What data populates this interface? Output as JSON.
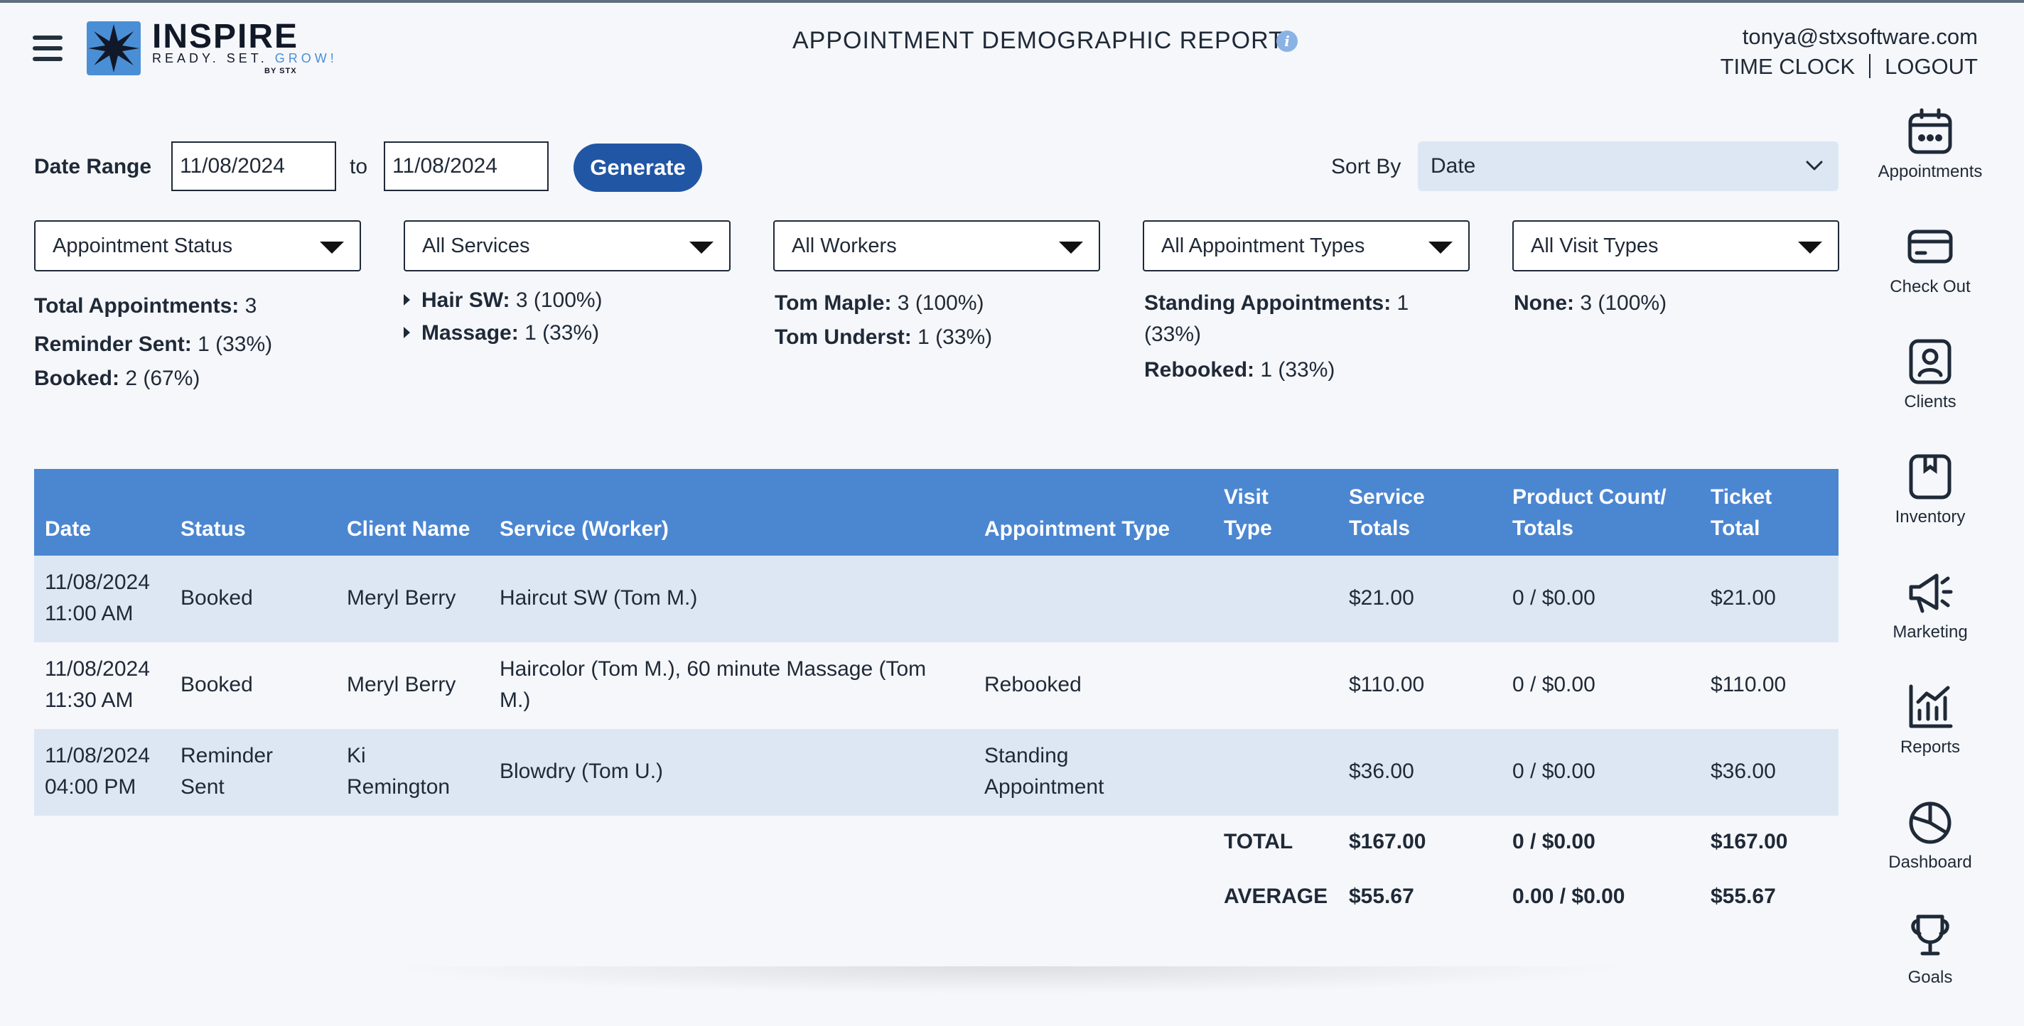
{
  "header": {
    "brand_name": "INSPIRE",
    "brand_tagline_main": "READY. SET. ",
    "brand_tagline_accent": "GROW!",
    "brand_by": "BY STX",
    "title": "APPOINTMENT DEMOGRAPHIC REPORT",
    "user_email": "tonya@stxsoftware.com",
    "time_clock": "TIME CLOCK",
    "logout": "LOGOUT"
  },
  "filters": {
    "date_range_label": "Date Range",
    "date_from": "11/08/2024",
    "to_label": "to",
    "date_to": "11/08/2024",
    "generate_label": "Generate",
    "sort_by_label": "Sort By",
    "sort_by_value": "Date",
    "dropdowns": [
      "Appointment Status",
      "All Services",
      "All Workers",
      "All Appointment Types",
      "All Visit Types"
    ]
  },
  "summary": {
    "status": [
      {
        "label": "Total Appointments:",
        "value": "3"
      },
      {
        "label": "Reminder Sent:",
        "value": "1 (33%)"
      },
      {
        "label": "Booked:",
        "value": "2 (67%)"
      }
    ],
    "services": [
      {
        "label": "Hair SW:",
        "value": "3 (100%)"
      },
      {
        "label": "Massage:",
        "value": "1 (33%)"
      }
    ],
    "workers": [
      {
        "label": "Tom Maple:",
        "value": "3 (100%)"
      },
      {
        "label": "Tom Underst:",
        "value": "1 (33%)"
      }
    ],
    "appointment_types": [
      {
        "label": "Standing Appointments:",
        "value_line1": "1",
        "value_line2": "(33%)"
      },
      {
        "label": "Rebooked:",
        "value": "1 (33%)"
      }
    ],
    "visit_types": [
      {
        "label": "None:",
        "value": "3 (100%)"
      }
    ]
  },
  "table": {
    "columns": [
      [
        "Date"
      ],
      [
        "Status"
      ],
      [
        "Client Name"
      ],
      [
        "Service (Worker)"
      ],
      [
        "Appointment Type"
      ],
      [
        "Visit",
        "Type"
      ],
      [
        "Service",
        "Totals"
      ],
      [
        "Product Count/",
        "Totals"
      ],
      [
        "Ticket",
        "Total"
      ]
    ],
    "rows": [
      {
        "date": [
          "11/08/2024",
          "11:00 AM"
        ],
        "status": [
          "Booked"
        ],
        "client": [
          "Meryl Berry"
        ],
        "service": [
          "Haircut SW (Tom M.)"
        ],
        "appt_type": [
          ""
        ],
        "visit_type": [
          ""
        ],
        "service_total": "$21.00",
        "product": "0 / $0.00",
        "ticket_total": "$21.00"
      },
      {
        "date": [
          "11/08/2024",
          "11:30 AM"
        ],
        "status": [
          "Booked"
        ],
        "client": [
          "Meryl Berry"
        ],
        "service": [
          "Haircolor (Tom M.), 60 minute Massage (Tom",
          "M.)"
        ],
        "appt_type": [
          "Rebooked"
        ],
        "visit_type": [
          ""
        ],
        "service_total": "$110.00",
        "product": "0 / $0.00",
        "ticket_total": "$110.00"
      },
      {
        "date": [
          "11/08/2024",
          "04:00 PM"
        ],
        "status": [
          "Reminder",
          "Sent"
        ],
        "client": [
          "Ki",
          "Remington"
        ],
        "service": [
          "Blowdry (Tom U.)"
        ],
        "appt_type": [
          "Standing",
          "Appointment"
        ],
        "visit_type": [
          ""
        ],
        "service_total": "$36.00",
        "product": "0 / $0.00",
        "ticket_total": "$36.00"
      }
    ],
    "total": {
      "label": "TOTAL",
      "service": "$167.00",
      "product": "0 / $0.00",
      "ticket": "$167.00"
    },
    "average": {
      "label": "AVERAGE",
      "service": "$55.67",
      "product": "0.00 / $0.00",
      "ticket": "$55.67"
    }
  },
  "sidebar": {
    "items": [
      {
        "label": "Appointments",
        "icon": "calendar-icon"
      },
      {
        "label": "Check Out",
        "icon": "credit-card-icon"
      },
      {
        "label": "Clients",
        "icon": "client-icon"
      },
      {
        "label": "Inventory",
        "icon": "box-icon"
      },
      {
        "label": "Marketing",
        "icon": "megaphone-icon"
      },
      {
        "label": "Reports",
        "icon": "bar-chart-icon"
      },
      {
        "label": "Dashboard",
        "icon": "pie-chart-icon"
      },
      {
        "label": "Goals",
        "icon": "trophy-icon"
      }
    ]
  },
  "colors": {
    "accent": "#2156a5",
    "table_header": "#4b86d1",
    "row_alt": "#dde7f4",
    "background": "#f5f7fa",
    "info": "#8ab2e4"
  }
}
